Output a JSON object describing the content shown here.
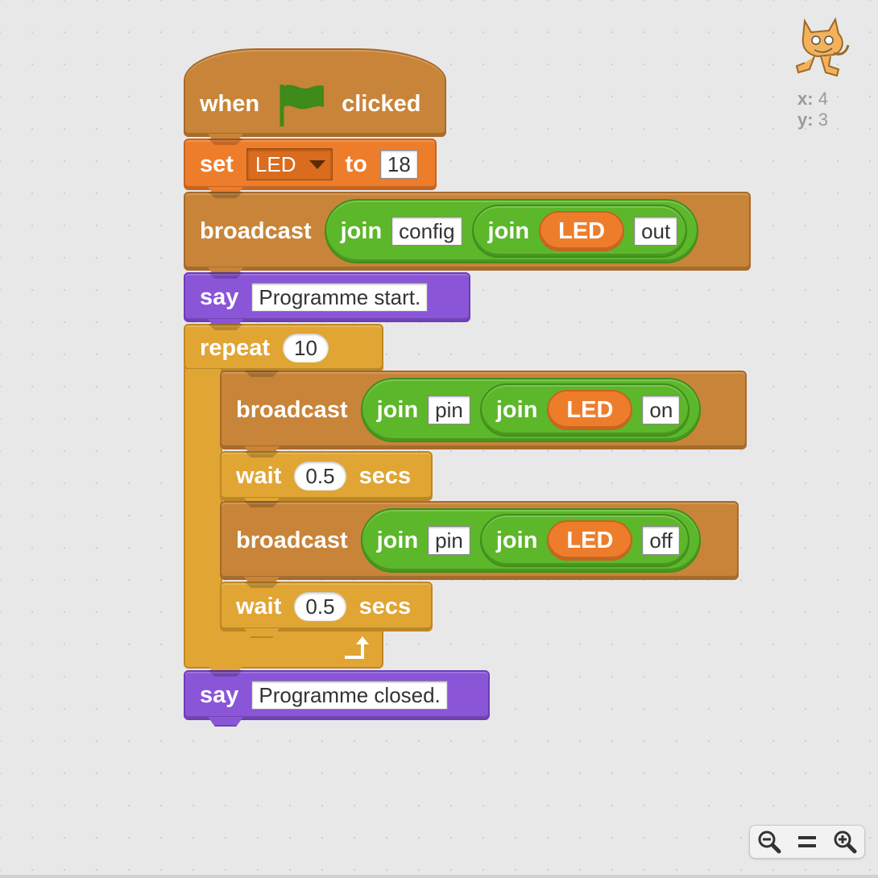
{
  "script": {
    "hat": {
      "when": "when",
      "clicked": "clicked",
      "icon": "green-flag-icon"
    },
    "set": {
      "label": "set",
      "variable": "LED",
      "to": "to",
      "value": "18"
    },
    "broadcast1": {
      "label": "broadcast",
      "join": "join",
      "arg1": "config",
      "inner_join": "join",
      "var": "LED",
      "arg2": "out"
    },
    "say1": {
      "label": "say",
      "text": "Programme start."
    },
    "repeat": {
      "label": "repeat",
      "count": "10"
    },
    "broadcast2": {
      "label": "broadcast",
      "join": "join",
      "arg1": "pin",
      "inner_join": "join",
      "var": "LED",
      "arg2": "on"
    },
    "wait1": {
      "label": "wait",
      "value": "0.5",
      "unit": "secs"
    },
    "broadcast3": {
      "label": "broadcast",
      "join": "join",
      "arg1": "pin",
      "inner_join": "join",
      "var": "LED",
      "arg2": "off"
    },
    "wait2": {
      "label": "wait",
      "value": "0.5",
      "unit": "secs"
    },
    "say2": {
      "label": "say",
      "text": "Programme closed."
    }
  },
  "sprite_info": {
    "x_label": "x:",
    "x": "4",
    "y_label": "y:",
    "y": "3"
  },
  "zoom": {
    "zoom_out": "zoom-out-icon",
    "reset": "zoom-reset-icon",
    "zoom_in": "zoom-in-icon"
  },
  "colors": {
    "events": "#c88438",
    "data": "#ee7d2b",
    "looks": "#8a55d7",
    "control": "#e1a534",
    "operators": "#5cb72a"
  }
}
